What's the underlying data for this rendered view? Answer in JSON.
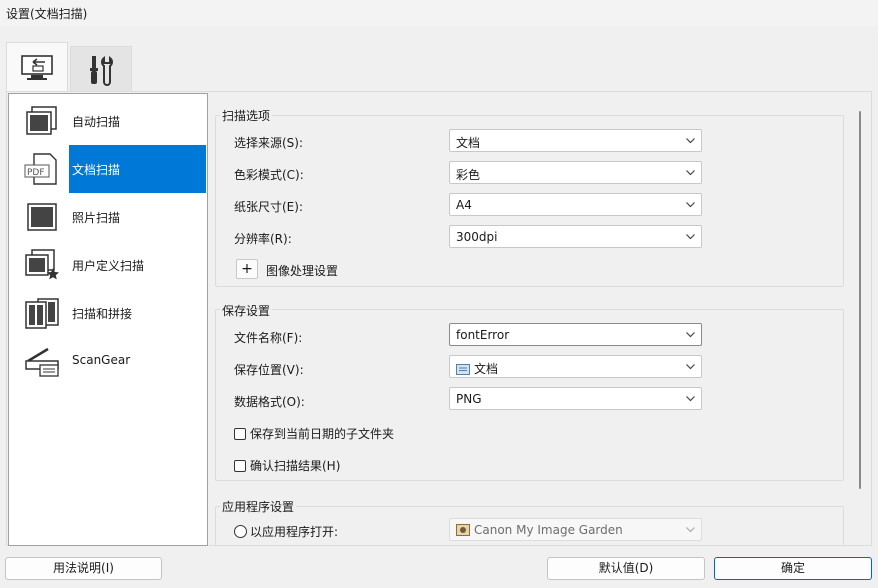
{
  "window": {
    "title": "设置(文档扫描)"
  },
  "tabs": [
    {
      "name": "scan-from-computer-tab",
      "icon": "computer-scan-icon"
    },
    {
      "name": "general-settings-tab",
      "icon": "tools-icon"
    }
  ],
  "sidebar": {
    "items": [
      {
        "label": "自动扫描",
        "icon": "auto-scan-icon"
      },
      {
        "label": "文档扫描",
        "icon": "pdf-document-icon",
        "selected": true
      },
      {
        "label": "照片扫描",
        "icon": "photo-scan-icon"
      },
      {
        "label": "用户定义扫描",
        "icon": "custom-scan-icon"
      },
      {
        "label": "扫描和拼接",
        "icon": "stitch-scan-icon"
      },
      {
        "label": "ScanGear",
        "icon": "scangear-icon"
      }
    ]
  },
  "scan_options": {
    "title": "扫描选项",
    "source_label": "选择来源(S):",
    "source_value": "文档",
    "color_label": "色彩模式(C):",
    "color_value": "彩色",
    "paper_label": "纸张尺寸(E):",
    "paper_value": "A4",
    "resolution_label": "分辨率(R):",
    "resolution_value": "300dpi",
    "image_processing_label": "图像处理设置",
    "expand_symbol": "+"
  },
  "save_settings": {
    "title": "保存设置",
    "filename_label": "文件名称(F):",
    "filename_value": "fontError",
    "location_label": "保存位置(V):",
    "location_value": "文档",
    "format_label": "数据格式(O):",
    "format_value": "PNG",
    "subfolder_label": "保存到当前日期的子文件夹",
    "confirm_label": "确认扫描结果(H)"
  },
  "app_settings": {
    "title": "应用程序设置",
    "open_with_label": "以应用程序打开:",
    "open_with_value": "Canon My Image Garden"
  },
  "footer": {
    "help_label": "用法说明(I)",
    "defaults_label": "默认值(D)",
    "ok_label": "确定"
  },
  "colors": {
    "accent": "#0078d7",
    "background": "#f0f0f0",
    "border": "#dcdcdc"
  }
}
